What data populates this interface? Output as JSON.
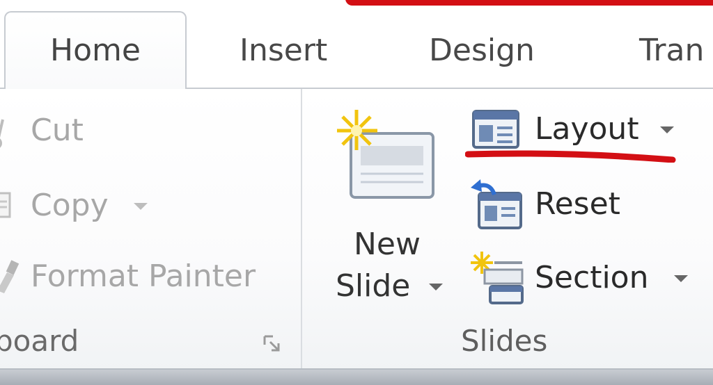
{
  "tabs": [
    {
      "label": "Home",
      "active": true
    },
    {
      "label": "Insert",
      "active": false
    },
    {
      "label": "Design",
      "active": false
    },
    {
      "label": "Tran",
      "active": false
    }
  ],
  "clipboard": {
    "cut_label": "Cut",
    "copy_label": "Copy",
    "format_painter_label": "Format Painter",
    "group_label": "board"
  },
  "slides": {
    "new_slide_line1": "New",
    "new_slide_line2": "Slide",
    "layout_label": "Layout",
    "reset_label": "Reset",
    "section_label": "Section",
    "group_label": "Slides"
  },
  "colors": {
    "annotation_red": "#d30f14",
    "disabled_text": "#a7a7a7"
  }
}
